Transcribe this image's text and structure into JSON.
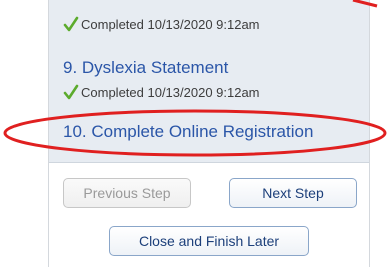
{
  "steps": [
    {
      "title": "",
      "status": "Completed 10/13/2020 9:12am"
    },
    {
      "title": "9. Dyslexia Statement",
      "status": "Completed 10/13/2020 9:12am"
    },
    {
      "title": "10. Complete Online Registration",
      "status": ""
    }
  ],
  "buttons": {
    "previous": "Previous Step",
    "next": "Next Step",
    "close": "Close and Finish Later"
  },
  "colors": {
    "accent_red": "#e02020",
    "link_blue": "#2b56a8",
    "check_green": "#5cab2d"
  }
}
